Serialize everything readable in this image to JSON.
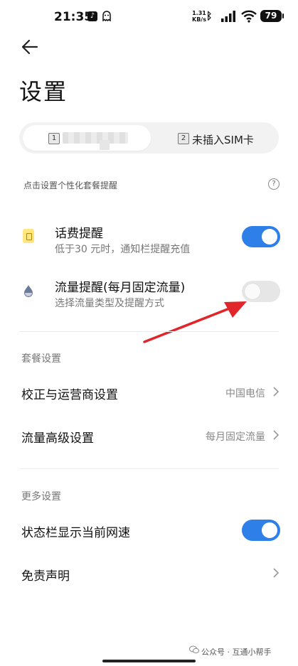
{
  "status_bar": {
    "time": "21:35",
    "net_speed_value": "1.31",
    "net_speed_unit": "KB/s",
    "battery": "79"
  },
  "header": {
    "back_icon": "arrow-left-icon",
    "title": "设置"
  },
  "sim_tabs": {
    "tab1_number": "1",
    "tab2_number": "2",
    "tab2_label": "未插入SIM卡"
  },
  "hint": {
    "text": "点击设置个性化套餐提醒",
    "help": "?"
  },
  "reminders": {
    "phone_fee": {
      "title": "话费提醒",
      "subtitle": "低于30 元时，通知栏提醒充值",
      "enabled": true
    },
    "data_usage": {
      "title": "流量提醒(每月固定流量)",
      "subtitle": "选择流量类型及提醒方式",
      "enabled": false
    }
  },
  "plan_settings": {
    "section_title": "套餐设置",
    "carrier": {
      "title": "校正与运营商设置",
      "value": "中国电信"
    },
    "advanced": {
      "title": "流量高级设置",
      "value": "每月固定流量"
    }
  },
  "more_settings": {
    "section_title": "更多设置",
    "show_speed": {
      "title": "状态栏显示当前网速",
      "enabled": true
    },
    "disclaimer": {
      "title": "免责声明"
    }
  },
  "watermark": {
    "text": "公众号 · 互通小帮手"
  },
  "colors": {
    "accent": "#2f7fe8",
    "annotation_arrow": "#e0262a"
  }
}
